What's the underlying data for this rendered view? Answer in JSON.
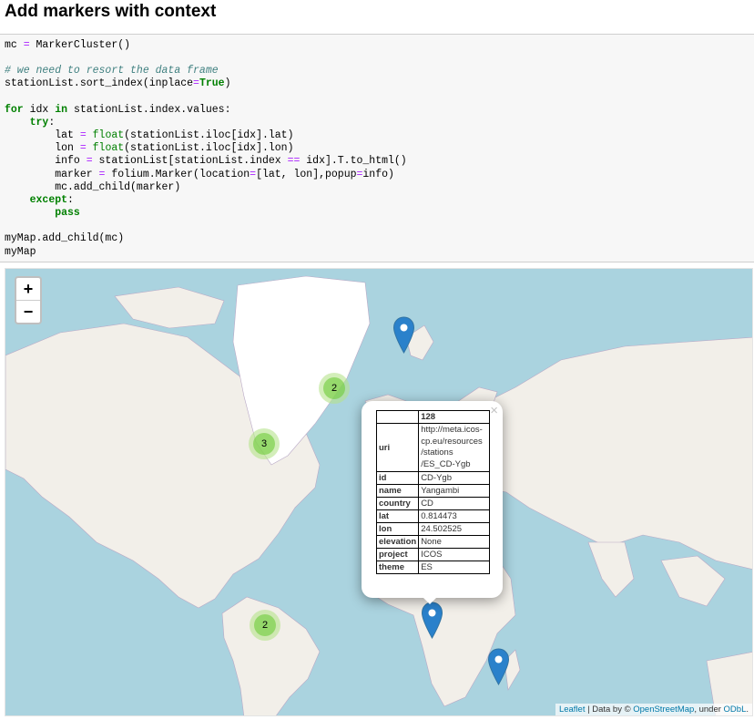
{
  "heading": "Add markers with context",
  "code": {
    "line1": {
      "a": "mc ",
      "b": "=",
      "c": " MarkerCluster()"
    },
    "line3": {
      "comment": "# we need to resort the data frame"
    },
    "line4": {
      "a": "stationList.sort_index(inplace",
      "b": "=",
      "c": "True",
      "d": ")"
    },
    "line6": {
      "a": "for",
      "b": " idx ",
      "c": "in",
      "d": " stationList.index.values:"
    },
    "line7": {
      "a": "    ",
      "b": "try",
      "c": ":"
    },
    "line8": {
      "a": "        lat ",
      "b": "=",
      "c": " ",
      "d": "float",
      "e": "(stationList.iloc[idx].lat)"
    },
    "line9": {
      "a": "        lon ",
      "b": "=",
      "c": " ",
      "d": "float",
      "e": "(stationList.iloc[idx].lon)"
    },
    "line10": {
      "a": "        info ",
      "b": "=",
      "c": " stationList[stationList.index ",
      "d": "==",
      "e": " idx].T.to_html()"
    },
    "line11": {
      "a": "        marker ",
      "b": "=",
      "c": " folium.Marker(location",
      "d": "=",
      "e": "[lat, lon],popup",
      "f": "=",
      "g": "info)"
    },
    "line12": {
      "a": "        mc.add_child(marker)"
    },
    "line13": {
      "a": "    ",
      "b": "except",
      "c": ":"
    },
    "line14": {
      "a": "        ",
      "b": "pass"
    },
    "line16": {
      "a": "myMap.add_child(mc)"
    },
    "line17": {
      "a": "myMap"
    }
  },
  "map": {
    "zoom_in": "+",
    "zoom_out": "−",
    "clusters": [
      {
        "count": "2"
      },
      {
        "count": "3"
      },
      {
        "count": "2"
      }
    ],
    "popup": {
      "close": "×",
      "index": "128",
      "rows": [
        {
          "key": "uri",
          "value": "http://meta.icos-cp.eu/resources/stations/ES_CD-Ygb"
        },
        {
          "key": "id",
          "value": "CD-Ygb"
        },
        {
          "key": "name",
          "value": "Yangambi"
        },
        {
          "key": "country",
          "value": "CD"
        },
        {
          "key": "lat",
          "value": "0.814473"
        },
        {
          "key": "lon",
          "value": "24.502525"
        },
        {
          "key": "elevation",
          "value": "None"
        },
        {
          "key": "project",
          "value": "ICOS"
        },
        {
          "key": "theme",
          "value": "ES"
        }
      ]
    },
    "attribution": {
      "leaflet": "Leaflet",
      "sep": " | Data by © ",
      "osm": "OpenStreetMap",
      "under": ", under ",
      "odbl": "ODbL",
      "end": "."
    },
    "colors": {
      "water": "#aad3df",
      "land": "#f2efe9",
      "ice": "#ffffff",
      "marker": "#2a81cb",
      "cluster_outer": "#b5e28c",
      "cluster_inner": "#6ecc39"
    }
  }
}
